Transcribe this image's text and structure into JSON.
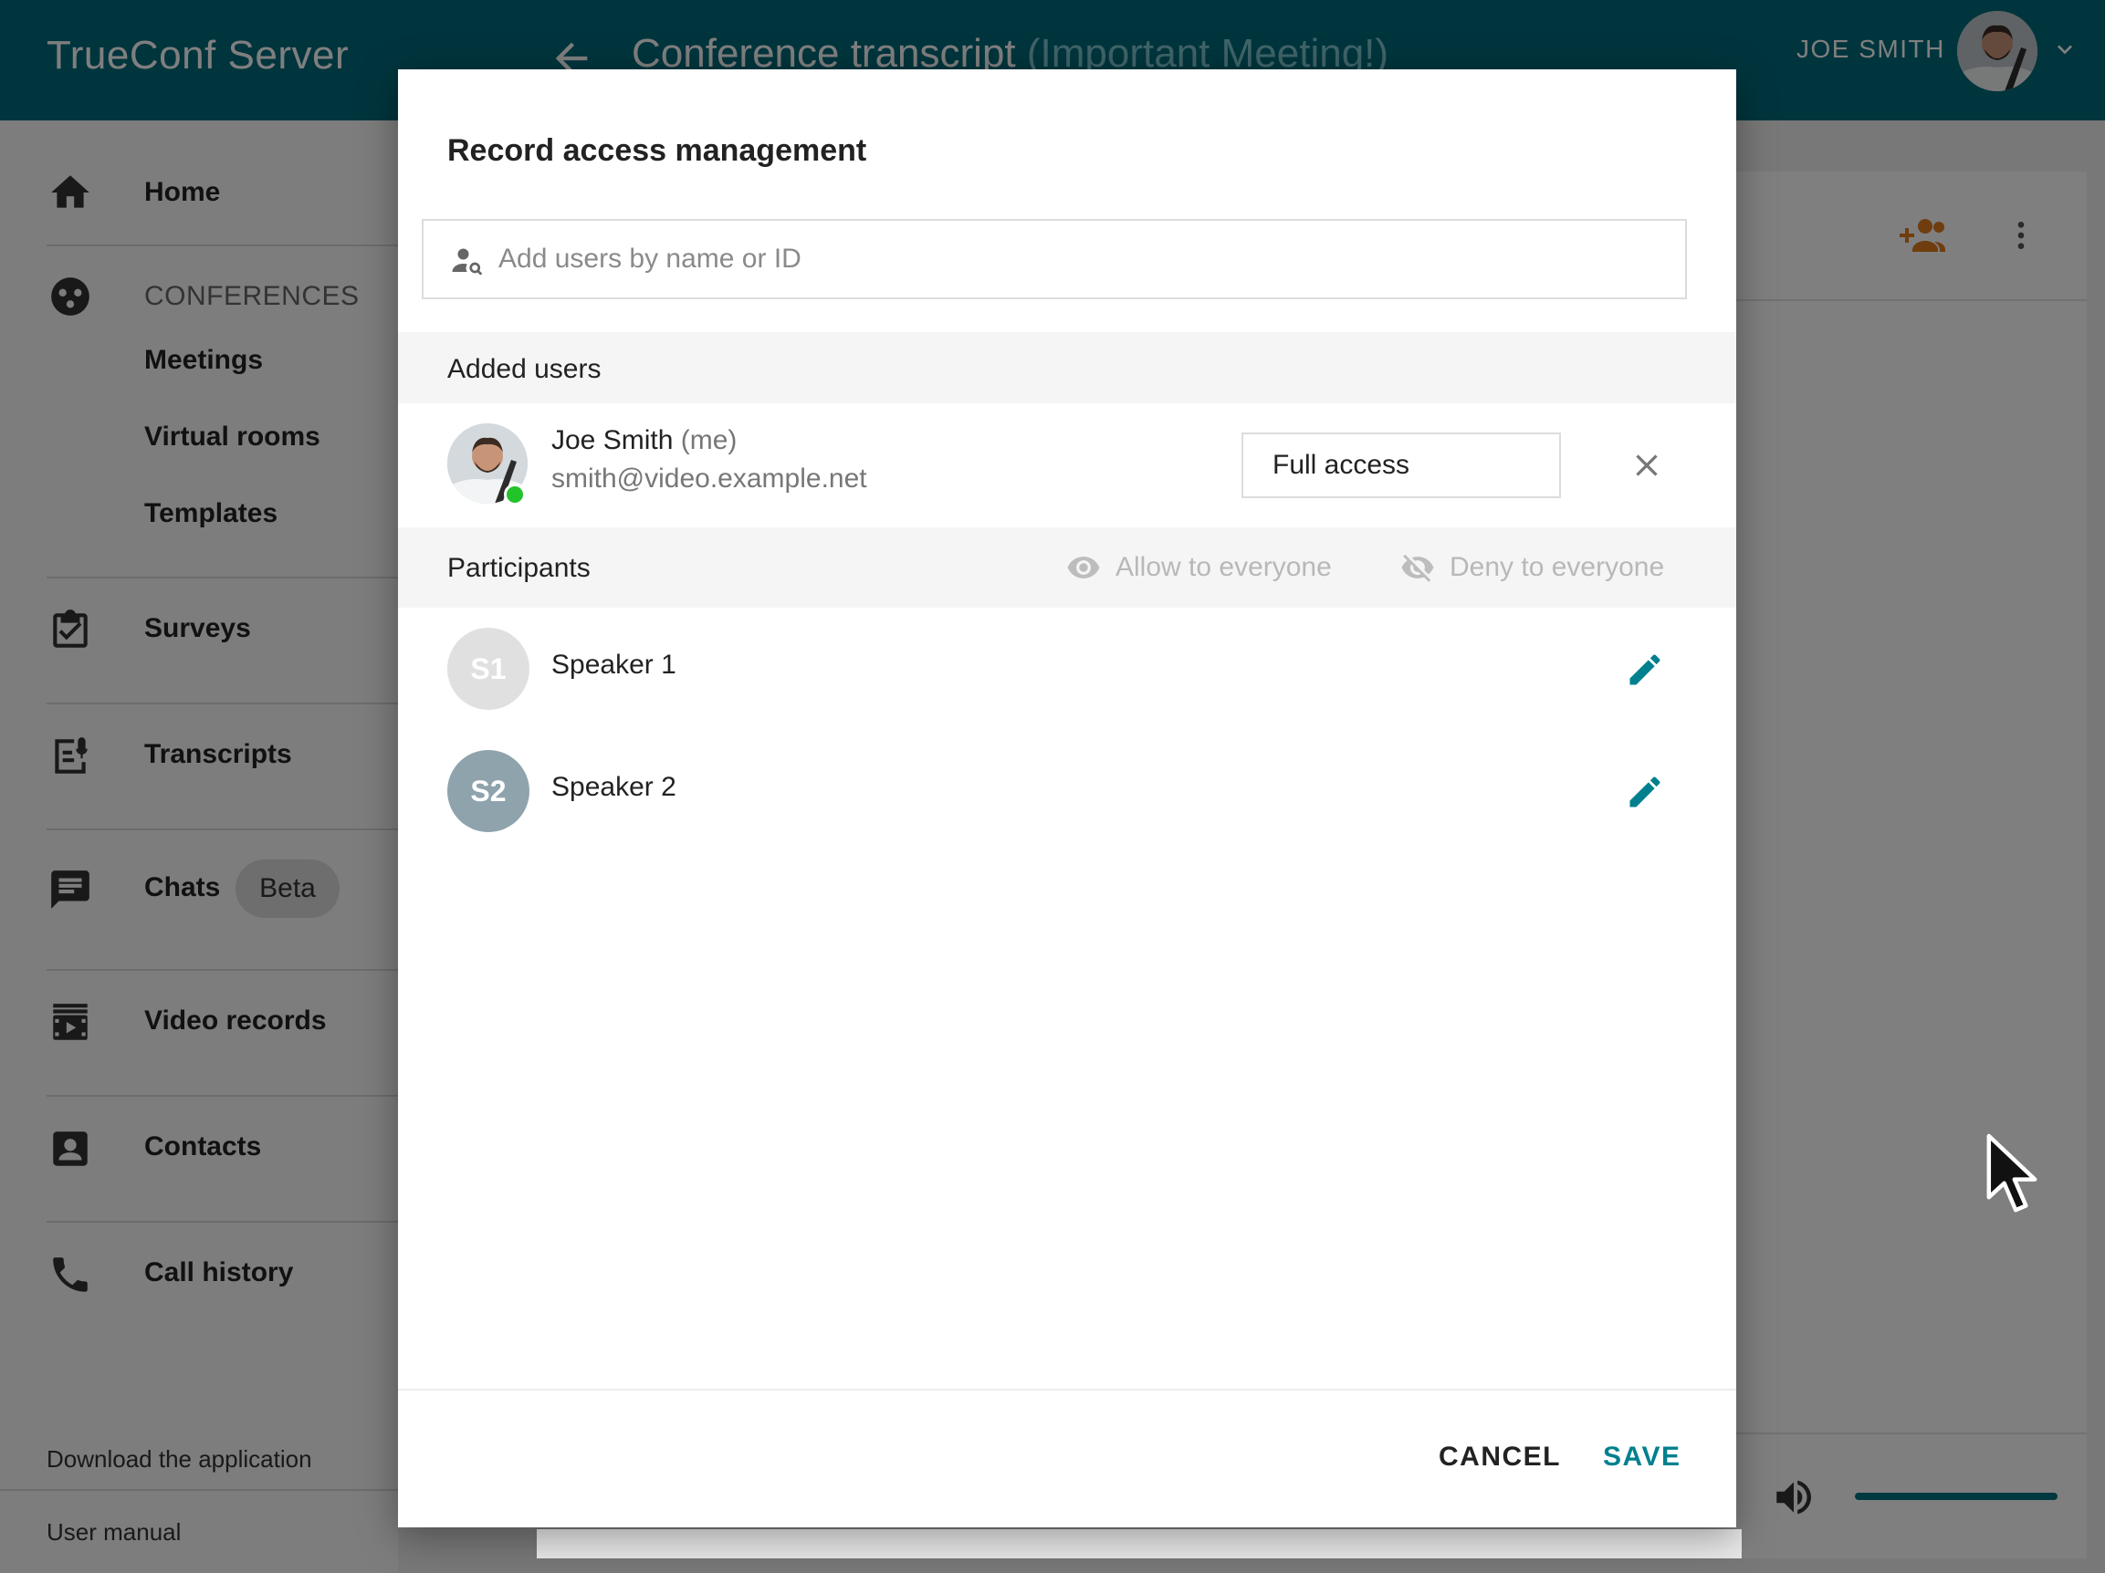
{
  "header": {
    "brand": "TrueConf Server",
    "title": "Conference transcript",
    "title_sub": "(Important Meeting!)",
    "user_name": "JOE SMITH"
  },
  "sidebar": {
    "home": "Home",
    "conferences_section": "CONFERENCES",
    "meetings": "Meetings",
    "virtual_rooms": "Virtual rooms",
    "templates": "Templates",
    "surveys": "Surveys",
    "transcripts": "Transcripts",
    "chats": "Chats",
    "chats_badge": "Beta",
    "video_records": "Video records",
    "contacts": "Contacts",
    "call_history": "Call history",
    "download_app": "Download the application",
    "user_manual": "User manual"
  },
  "player": {
    "progress": 1.0
  },
  "modal": {
    "title": "Record access management",
    "search_placeholder": "Add users by name or ID",
    "added_users_label": "Added users",
    "added_user": {
      "name": "Joe Smith",
      "me_tag": "(me)",
      "email": "smith@video.example.net",
      "access": "Full access"
    },
    "participants_label": "Participants",
    "allow_everyone": "Allow to everyone",
    "deny_everyone": "Deny to everyone",
    "speakers": [
      {
        "initials": "S1",
        "name": "Speaker 1",
        "color": "#e0e0e0"
      },
      {
        "initials": "S2",
        "name": "Speaker 2",
        "color": "#8fa3ad"
      }
    ],
    "cancel_label": "CANCEL",
    "save_label": "SAVE"
  },
  "colors": {
    "brand": "#006a7a",
    "accent": "#00808f",
    "orange": "#e07a1f",
    "online": "#22c32b"
  }
}
